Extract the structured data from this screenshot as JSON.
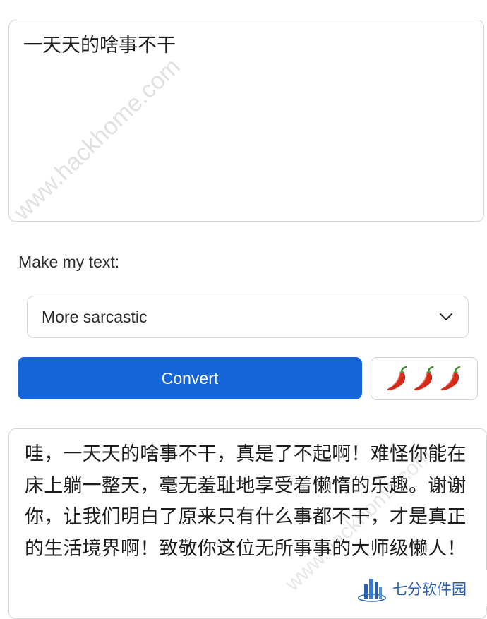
{
  "input": {
    "text": "一天天的啥事不干"
  },
  "mode": {
    "label": "Make my text:",
    "selected": "More sarcastic"
  },
  "convert": {
    "label": "Convert"
  },
  "spice": {
    "level": 3,
    "icon": "chili-pepper-icon"
  },
  "output": {
    "text": "哇，一天天的啥事不干，真是了不起啊！难怪你能在床上躺一整天，毫无羞耻地享受着懒惰的乐趣。谢谢你，让我们明白了原来只有什么事都不干，才是真正的生活境界啊！致敬你这位无所事事的大师级懒人！"
  },
  "watermarks": {
    "site": "www.hackhome.com",
    "site_partial": "www.hackhome.com",
    "logo_text": "七分软件园"
  },
  "colors": {
    "primary": "#1565d8",
    "border": "#d4d4d4",
    "pepper": "#d42a1a"
  }
}
